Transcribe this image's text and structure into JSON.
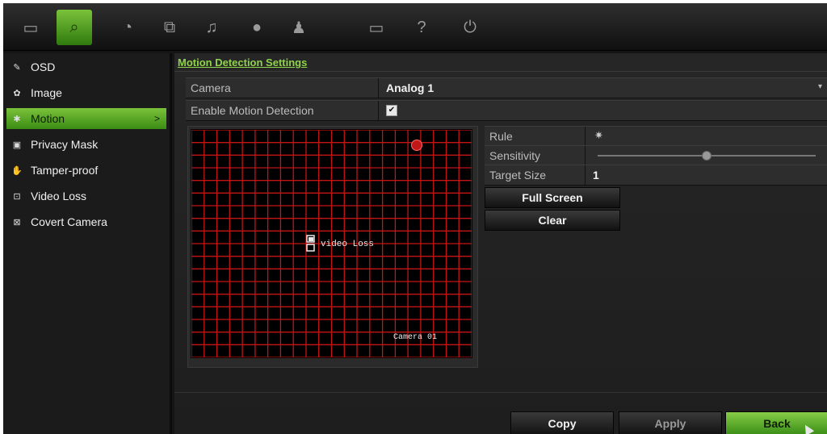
{
  "topbar": {
    "icons": [
      {
        "name": "display-icon",
        "glyph": "▭",
        "active": false
      },
      {
        "name": "camera-setup-icon",
        "glyph": "⌕",
        "active": true
      },
      {
        "name": "clock-icon",
        "glyph": "◔",
        "active": false
      },
      {
        "name": "network-icon",
        "glyph": "⧉",
        "active": false
      },
      {
        "name": "alarm-bell-icon",
        "glyph": "♫",
        "active": false
      },
      {
        "name": "device-icon",
        "glyph": "●",
        "active": false
      },
      {
        "name": "user-icon",
        "glyph": "♟",
        "active": false
      },
      {
        "name": "storage-icon",
        "glyph": "▭",
        "active": false
      },
      {
        "name": "help-icon",
        "glyph": "?",
        "active": false
      },
      {
        "name": "power-icon",
        "glyph": "⏻",
        "active": false
      }
    ]
  },
  "sidebar": {
    "items": [
      {
        "label": "OSD",
        "icon": "osd-icon",
        "glyph": "✎",
        "active": false
      },
      {
        "label": "Image",
        "icon": "image-icon",
        "glyph": "✿",
        "active": false
      },
      {
        "label": "Motion",
        "icon": "motion-icon",
        "glyph": "✱",
        "active": true
      },
      {
        "label": "Privacy Mask",
        "icon": "privacy-mask-icon",
        "glyph": "▣",
        "active": false
      },
      {
        "label": "Tamper-proof",
        "icon": "tamper-icon",
        "glyph": "✋",
        "active": false
      },
      {
        "label": "Video Loss",
        "icon": "video-loss-icon",
        "glyph": "⊡",
        "active": false
      },
      {
        "label": "Covert Camera",
        "icon": "covert-camera-icon",
        "glyph": "⊠",
        "active": false
      }
    ],
    "active_chevron": ">"
  },
  "main": {
    "title": "Motion Detection Settings",
    "camera": {
      "label": "Camera",
      "value": "Analog 1"
    },
    "enable_motion": {
      "label": "Enable Motion Detection",
      "checked": true,
      "check_glyph": "✔"
    },
    "preview": {
      "camera_osd": "Camera 01",
      "video_loss_osd": "video Loss",
      "grid_color": "#c41414"
    },
    "rule": {
      "label": "Rule",
      "glyph": "✷"
    },
    "sensitivity": {
      "label": "Sensitivity",
      "level_fraction": 0.5
    },
    "target_size": {
      "label": "Target Size",
      "value": "1"
    },
    "full_screen_label": "Full Screen",
    "clear_label": "Clear"
  },
  "footer": {
    "copy_label": "Copy",
    "apply_label": "Apply",
    "back_label": "Back"
  },
  "colors": {
    "accent": "#6fbf2a",
    "title": "#8fd34a"
  }
}
